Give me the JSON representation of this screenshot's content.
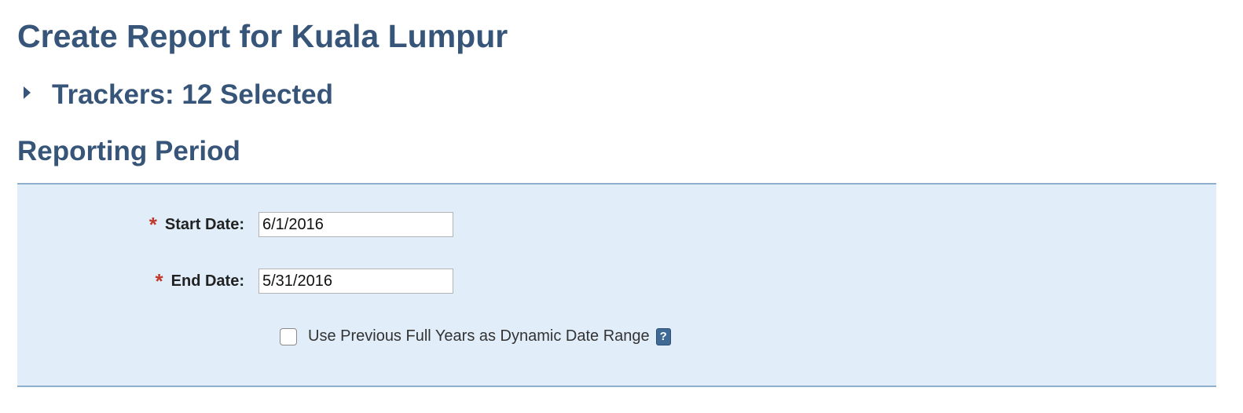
{
  "header": {
    "title": "Create Report for Kuala Lumpur"
  },
  "trackers": {
    "title": "Trackers: 12 Selected",
    "expanded": false
  },
  "reporting_period": {
    "title": "Reporting Period",
    "required_marker": "*",
    "start_date": {
      "label": "Start Date:",
      "value": "6/1/2016"
    },
    "end_date": {
      "label": "End Date:",
      "value": "5/31/2016"
    },
    "dynamic_range": {
      "label": "Use Previous Full Years as Dynamic Date Range",
      "checked": false,
      "help_glyph": "?"
    }
  },
  "colors": {
    "heading": "#375578",
    "panel_background": "#e1eef9",
    "panel_border": "#8fb0cc",
    "required": "#c0392b",
    "help_icon": "#3f6a96"
  },
  "icons": {
    "expand": "caret-right-icon",
    "help": "help-icon"
  }
}
